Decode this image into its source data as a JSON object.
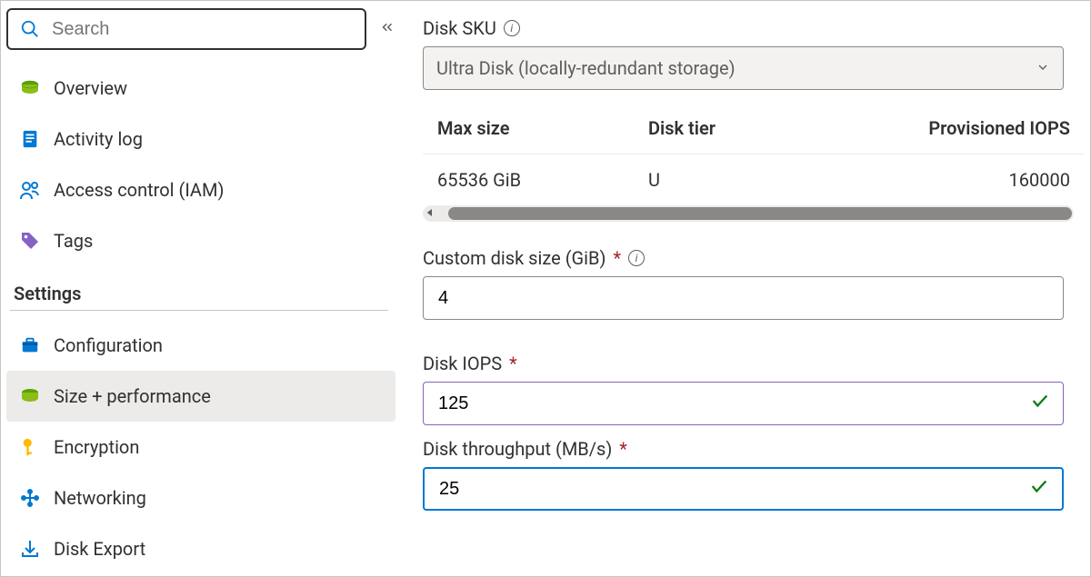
{
  "sidebar": {
    "search_placeholder": "Search",
    "items": [
      {
        "icon": "disk",
        "label": "Overview"
      },
      {
        "icon": "log",
        "label": "Activity log"
      },
      {
        "icon": "people",
        "label": "Access control (IAM)"
      },
      {
        "icon": "tag",
        "label": "Tags"
      }
    ],
    "settings_header": "Settings",
    "settings_items": [
      {
        "icon": "toolbox",
        "label": "Configuration"
      },
      {
        "icon": "disk",
        "label": "Size + performance",
        "selected": true
      },
      {
        "icon": "key",
        "label": "Encryption"
      },
      {
        "icon": "network",
        "label": "Networking"
      },
      {
        "icon": "export",
        "label": "Disk Export"
      }
    ]
  },
  "main": {
    "disk_sku_label": "Disk SKU",
    "disk_sku_value": "Ultra Disk (locally-redundant storage)",
    "table": {
      "headers": [
        "Max size",
        "Disk tier",
        "Provisioned IOPS"
      ],
      "row": [
        "65536 GiB",
        "U",
        "160000"
      ]
    },
    "custom_size_label": "Custom disk size (GiB)",
    "custom_size_value": "4",
    "iops_label": "Disk IOPS",
    "iops_value": "125",
    "throughput_label": "Disk throughput (MB/s)",
    "throughput_value": "25"
  }
}
